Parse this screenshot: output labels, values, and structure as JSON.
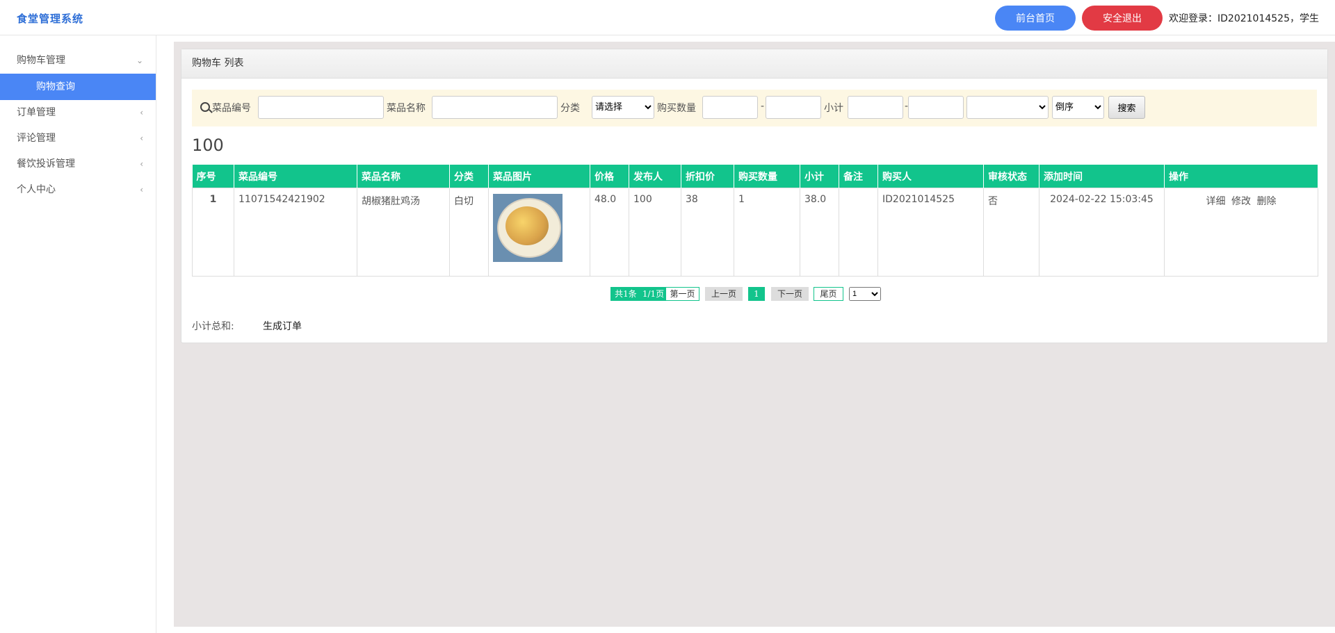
{
  "header": {
    "brand": "食堂管理系统",
    "home_button": "前台首页",
    "logout_button": "安全退出",
    "welcome": "欢迎登录：ID2021014525，学生"
  },
  "sidebar": {
    "items": [
      {
        "label": "购物车管理",
        "expanded": true,
        "children": [
          {
            "label": "购物查询",
            "active": true
          }
        ]
      },
      {
        "label": "订单管理"
      },
      {
        "label": "评论管理"
      },
      {
        "label": "餐饮投诉管理"
      },
      {
        "label": "个人中心"
      }
    ]
  },
  "panel": {
    "title": "购物车 列表"
  },
  "search": {
    "code_label": "菜品编号",
    "name_label": "菜品名称",
    "category_label": "分类",
    "category_value": "请选择",
    "qty_label": "购买数量",
    "dash1": "-",
    "subtotal_label": "小计",
    "dash2": "-",
    "order_value": "倒序",
    "search_button": "搜索"
  },
  "total_count": "100",
  "table": {
    "columns": [
      "序号",
      "菜品编号",
      "菜品名称",
      "分类",
      "菜品图片",
      "价格",
      "发布人",
      "折扣价",
      "购买数量",
      "小计",
      "备注",
      "购买人",
      "审核状态",
      "添加时间",
      "操作"
    ],
    "rows": [
      {
        "index": "1",
        "code": "11071542421902",
        "name": "胡椒猪肚鸡汤",
        "category": "白切",
        "price": "48.0",
        "publisher": "100",
        "discount": "38",
        "qty": "1",
        "subtotal": "38.0",
        "remark": "",
        "buyer": "ID2021014525",
        "audit": "否",
        "time": "2024-02-22 15:03:45",
        "ops": [
          "详细",
          "修改",
          "删除"
        ]
      }
    ]
  },
  "pager": {
    "total": "共1条",
    "pages": "1/1页",
    "first": "第一页",
    "prev": "上一页",
    "current": "1",
    "next": "下一页",
    "last": "尾页",
    "jump_value": "1"
  },
  "footer": {
    "sum_label": "小计总和:",
    "make_order": "生成订单"
  },
  "colors": {
    "accent": "#4a86f5",
    "danger": "#e23a44",
    "table_header": "#12c48c"
  }
}
